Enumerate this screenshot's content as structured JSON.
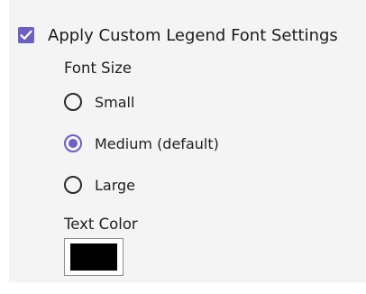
{
  "apply_custom": {
    "label": "Apply Custom Legend Font Settings",
    "checked": true
  },
  "font_size": {
    "label": "Font Size",
    "options": [
      {
        "label": "Small",
        "selected": false
      },
      {
        "label": "Medium (default)",
        "selected": true
      },
      {
        "label": "Large",
        "selected": false
      }
    ]
  },
  "text_color": {
    "label": "Text Color",
    "value": "#000000"
  },
  "colors": {
    "accent": "#6d5fc4",
    "panel_background": "#f4f4f4"
  }
}
